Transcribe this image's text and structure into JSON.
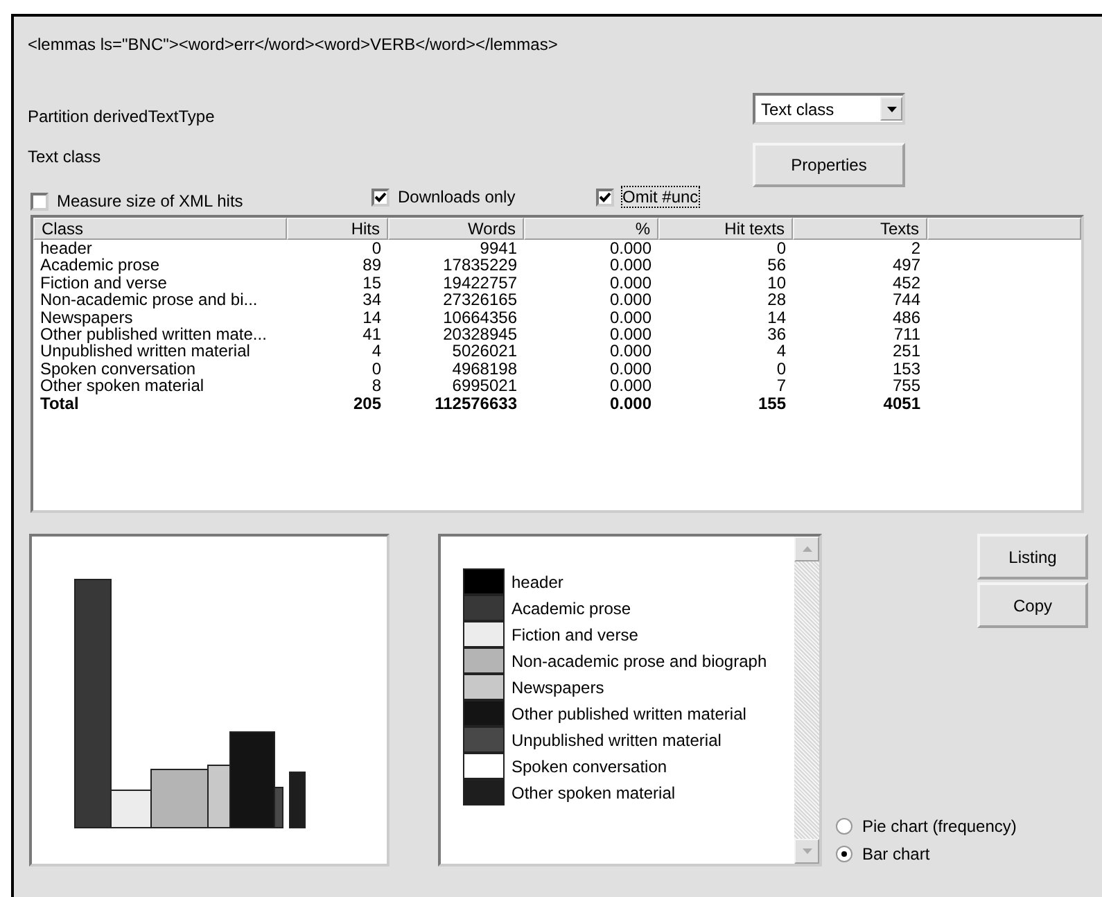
{
  "query": "<lemmas ls=\"BNC\"><word>err</word><word>VERB</word></lemmas>",
  "partition_label": "Partition derivedTextType",
  "partition_value": "Text class",
  "dropdown": {
    "value": "Text class"
  },
  "properties_button": "Properties",
  "checkboxes": [
    {
      "label": "Measure size of XML hits",
      "checked": false,
      "focused": false
    },
    {
      "label": "Downloads only",
      "checked": true,
      "focused": false
    },
    {
      "label": "Omit #unc",
      "checked": true,
      "focused": true
    }
  ],
  "table": {
    "columns": [
      "Class",
      "Hits",
      "Words",
      "%",
      "Hit texts",
      "Texts"
    ],
    "rows": [
      {
        "kind": "data",
        "cells": [
          "header",
          "0",
          "9941",
          "0.000",
          "0",
          "2"
        ]
      },
      {
        "kind": "data",
        "cells": [
          "Academic prose",
          "89",
          "17835229",
          "0.000",
          "56",
          "497"
        ]
      },
      {
        "kind": "data",
        "cells": [
          "Fiction and verse",
          "15",
          "19422757",
          "0.000",
          "10",
          "452"
        ]
      },
      {
        "kind": "data",
        "cells": [
          "Non-academic prose and bi...",
          "34",
          "27326165",
          "0.000",
          "28",
          "744"
        ]
      },
      {
        "kind": "data",
        "cells": [
          "Newspapers",
          "14",
          "10664356",
          "0.000",
          "14",
          "486"
        ]
      },
      {
        "kind": "data",
        "cells": [
          "Other published written mate...",
          "41",
          "20328945",
          "0.000",
          "36",
          "711"
        ]
      },
      {
        "kind": "data",
        "cells": [
          "Unpublished written material",
          "4",
          "5026021",
          "0.000",
          "4",
          "251"
        ]
      },
      {
        "kind": "data",
        "cells": [
          "Spoken conversation",
          "0",
          "4968198",
          "0.000",
          "0",
          "153"
        ]
      },
      {
        "kind": "data",
        "cells": [
          "Other spoken material",
          "8",
          "6995021",
          "0.000",
          "7",
          "755"
        ]
      },
      {
        "kind": "total",
        "cells": [
          "Total",
          "205",
          "112576633",
          "0.000",
          "155",
          "4051"
        ]
      }
    ]
  },
  "legend": [
    {
      "label": "header",
      "color": "#000000"
    },
    {
      "label": "Academic prose",
      "color": "#383838"
    },
    {
      "label": "Fiction and verse",
      "color": "#ececec"
    },
    {
      "label": "Non-academic prose and biograph",
      "color": "#b4b4b4"
    },
    {
      "label": "Newspapers",
      "color": "#c8c8c8"
    },
    {
      "label": "Other published written material",
      "color": "#141414"
    },
    {
      "label": "Unpublished written material",
      "color": "#484848"
    },
    {
      "label": "Spoken conversation",
      "color": "#ffffff"
    },
    {
      "label": "Other spoken material",
      "color": "#1e1e1e"
    }
  ],
  "buttons": [
    "Listing",
    "Copy"
  ],
  "radios": [
    {
      "label": "Pie chart (frequency)",
      "selected": false
    },
    {
      "label": "Bar chart",
      "selected": true
    }
  ]
}
